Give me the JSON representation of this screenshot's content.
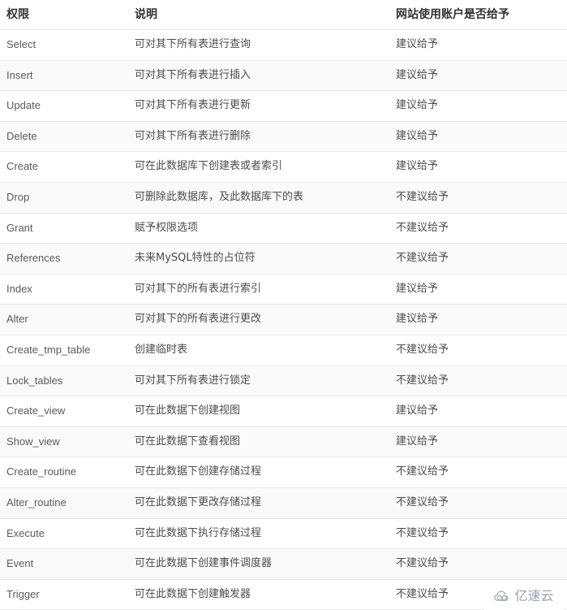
{
  "table": {
    "columns": [
      "权限",
      "说明",
      "网站使用账户是否给予"
    ],
    "rows": [
      {
        "name": "Select",
        "desc": "可对其下所有表进行查询",
        "advice": "建议给予"
      },
      {
        "name": "Insert",
        "desc": "可对其下所有表进行插入",
        "advice": "建议给予"
      },
      {
        "name": "Update",
        "desc": "可对其下所有表进行更新",
        "advice": "建议给予"
      },
      {
        "name": "Delete",
        "desc": "可对其下所有表进行删除",
        "advice": "建议给予"
      },
      {
        "name": "Create",
        "desc": "可在此数据库下创建表或者索引",
        "advice": "建议给予"
      },
      {
        "name": "Drop",
        "desc": "可删除此数据库，及此数据库下的表",
        "advice": "不建议给予"
      },
      {
        "name": "Grant",
        "desc": "赋予权限选项",
        "advice": "不建议给予"
      },
      {
        "name": "References",
        "desc": "未来MySQL特性的占位符",
        "advice": "不建议给予"
      },
      {
        "name": "Index",
        "desc": "可对其下的所有表进行索引",
        "advice": "建议给予"
      },
      {
        "name": "Alter",
        "desc": "可对其下的所有表进行更改",
        "advice": "建议给予"
      },
      {
        "name": "Create_tmp_table",
        "desc": "创建临时表",
        "advice": "不建议给予"
      },
      {
        "name": "Lock_tables",
        "desc": "可对其下所有表进行锁定",
        "advice": "不建议给予"
      },
      {
        "name": "Create_view",
        "desc": "可在此数据下创建视图",
        "advice": "建议给予"
      },
      {
        "name": "Show_view",
        "desc": "可在此数据下查看视图",
        "advice": "建议给予"
      },
      {
        "name": "Create_routine",
        "desc": "可在此数据下创建存储过程",
        "advice": "不建议给予"
      },
      {
        "name": "Alter_routine",
        "desc": "可在此数据下更改存储过程",
        "advice": "不建议给予"
      },
      {
        "name": "Execute",
        "desc": "可在此数据下执行存储过程",
        "advice": "不建议给予"
      },
      {
        "name": "Event",
        "desc": "可在此数据下创建事件调度器",
        "advice": "不建议给予"
      },
      {
        "name": "Trigger",
        "desc": "可在此数据下创建触发器",
        "advice": "不建议给予"
      }
    ]
  },
  "watermark": {
    "text": "亿速云",
    "icon": "cloud-icon",
    "color": "#9aa3ad"
  },
  "colors": {
    "header_text": "#333333",
    "body_text": "#4d4d4d",
    "name_text": "#5a5a5a",
    "row_border": "#e9e9e9",
    "header_border": "#e4e4e4",
    "stripe": "#fafafa",
    "background": "#ffffff"
  }
}
